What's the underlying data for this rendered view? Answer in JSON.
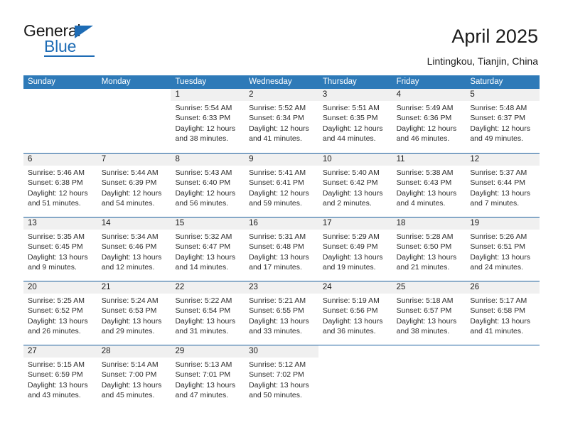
{
  "brand": {
    "name_top": "General",
    "name_bottom": "Blue",
    "accent_color": "#1e6cb5"
  },
  "header": {
    "title": "April 2025",
    "subtitle": "Lintingkou, Tianjin, China"
  },
  "calendar": {
    "header_bg": "#2e7ab8",
    "row_divider_color": "#1a5f9e",
    "daynum_bg": "#f0f0f0",
    "weekdays": [
      "Sunday",
      "Monday",
      "Tuesday",
      "Wednesday",
      "Thursday",
      "Friday",
      "Saturday"
    ],
    "weeks": [
      [
        {
          "day": "",
          "lines": []
        },
        {
          "day": "",
          "lines": []
        },
        {
          "day": "1",
          "lines": [
            "Sunrise: 5:54 AM",
            "Sunset: 6:33 PM",
            "Daylight: 12 hours",
            "and 38 minutes."
          ]
        },
        {
          "day": "2",
          "lines": [
            "Sunrise: 5:52 AM",
            "Sunset: 6:34 PM",
            "Daylight: 12 hours",
            "and 41 minutes."
          ]
        },
        {
          "day": "3",
          "lines": [
            "Sunrise: 5:51 AM",
            "Sunset: 6:35 PM",
            "Daylight: 12 hours",
            "and 44 minutes."
          ]
        },
        {
          "day": "4",
          "lines": [
            "Sunrise: 5:49 AM",
            "Sunset: 6:36 PM",
            "Daylight: 12 hours",
            "and 46 minutes."
          ]
        },
        {
          "day": "5",
          "lines": [
            "Sunrise: 5:48 AM",
            "Sunset: 6:37 PM",
            "Daylight: 12 hours",
            "and 49 minutes."
          ]
        }
      ],
      [
        {
          "day": "6",
          "lines": [
            "Sunrise: 5:46 AM",
            "Sunset: 6:38 PM",
            "Daylight: 12 hours",
            "and 51 minutes."
          ]
        },
        {
          "day": "7",
          "lines": [
            "Sunrise: 5:44 AM",
            "Sunset: 6:39 PM",
            "Daylight: 12 hours",
            "and 54 minutes."
          ]
        },
        {
          "day": "8",
          "lines": [
            "Sunrise: 5:43 AM",
            "Sunset: 6:40 PM",
            "Daylight: 12 hours",
            "and 56 minutes."
          ]
        },
        {
          "day": "9",
          "lines": [
            "Sunrise: 5:41 AM",
            "Sunset: 6:41 PM",
            "Daylight: 12 hours",
            "and 59 minutes."
          ]
        },
        {
          "day": "10",
          "lines": [
            "Sunrise: 5:40 AM",
            "Sunset: 6:42 PM",
            "Daylight: 13 hours",
            "and 2 minutes."
          ]
        },
        {
          "day": "11",
          "lines": [
            "Sunrise: 5:38 AM",
            "Sunset: 6:43 PM",
            "Daylight: 13 hours",
            "and 4 minutes."
          ]
        },
        {
          "day": "12",
          "lines": [
            "Sunrise: 5:37 AM",
            "Sunset: 6:44 PM",
            "Daylight: 13 hours",
            "and 7 minutes."
          ]
        }
      ],
      [
        {
          "day": "13",
          "lines": [
            "Sunrise: 5:35 AM",
            "Sunset: 6:45 PM",
            "Daylight: 13 hours",
            "and 9 minutes."
          ]
        },
        {
          "day": "14",
          "lines": [
            "Sunrise: 5:34 AM",
            "Sunset: 6:46 PM",
            "Daylight: 13 hours",
            "and 12 minutes."
          ]
        },
        {
          "day": "15",
          "lines": [
            "Sunrise: 5:32 AM",
            "Sunset: 6:47 PM",
            "Daylight: 13 hours",
            "and 14 minutes."
          ]
        },
        {
          "day": "16",
          "lines": [
            "Sunrise: 5:31 AM",
            "Sunset: 6:48 PM",
            "Daylight: 13 hours",
            "and 17 minutes."
          ]
        },
        {
          "day": "17",
          "lines": [
            "Sunrise: 5:29 AM",
            "Sunset: 6:49 PM",
            "Daylight: 13 hours",
            "and 19 minutes."
          ]
        },
        {
          "day": "18",
          "lines": [
            "Sunrise: 5:28 AM",
            "Sunset: 6:50 PM",
            "Daylight: 13 hours",
            "and 21 minutes."
          ]
        },
        {
          "day": "19",
          "lines": [
            "Sunrise: 5:26 AM",
            "Sunset: 6:51 PM",
            "Daylight: 13 hours",
            "and 24 minutes."
          ]
        }
      ],
      [
        {
          "day": "20",
          "lines": [
            "Sunrise: 5:25 AM",
            "Sunset: 6:52 PM",
            "Daylight: 13 hours",
            "and 26 minutes."
          ]
        },
        {
          "day": "21",
          "lines": [
            "Sunrise: 5:24 AM",
            "Sunset: 6:53 PM",
            "Daylight: 13 hours",
            "and 29 minutes."
          ]
        },
        {
          "day": "22",
          "lines": [
            "Sunrise: 5:22 AM",
            "Sunset: 6:54 PM",
            "Daylight: 13 hours",
            "and 31 minutes."
          ]
        },
        {
          "day": "23",
          "lines": [
            "Sunrise: 5:21 AM",
            "Sunset: 6:55 PM",
            "Daylight: 13 hours",
            "and 33 minutes."
          ]
        },
        {
          "day": "24",
          "lines": [
            "Sunrise: 5:19 AM",
            "Sunset: 6:56 PM",
            "Daylight: 13 hours",
            "and 36 minutes."
          ]
        },
        {
          "day": "25",
          "lines": [
            "Sunrise: 5:18 AM",
            "Sunset: 6:57 PM",
            "Daylight: 13 hours",
            "and 38 minutes."
          ]
        },
        {
          "day": "26",
          "lines": [
            "Sunrise: 5:17 AM",
            "Sunset: 6:58 PM",
            "Daylight: 13 hours",
            "and 41 minutes."
          ]
        }
      ],
      [
        {
          "day": "27",
          "lines": [
            "Sunrise: 5:15 AM",
            "Sunset: 6:59 PM",
            "Daylight: 13 hours",
            "and 43 minutes."
          ]
        },
        {
          "day": "28",
          "lines": [
            "Sunrise: 5:14 AM",
            "Sunset: 7:00 PM",
            "Daylight: 13 hours",
            "and 45 minutes."
          ]
        },
        {
          "day": "29",
          "lines": [
            "Sunrise: 5:13 AM",
            "Sunset: 7:01 PM",
            "Daylight: 13 hours",
            "and 47 minutes."
          ]
        },
        {
          "day": "30",
          "lines": [
            "Sunrise: 5:12 AM",
            "Sunset: 7:02 PM",
            "Daylight: 13 hours",
            "and 50 minutes."
          ]
        },
        {
          "day": "",
          "lines": []
        },
        {
          "day": "",
          "lines": []
        },
        {
          "day": "",
          "lines": []
        }
      ]
    ]
  }
}
